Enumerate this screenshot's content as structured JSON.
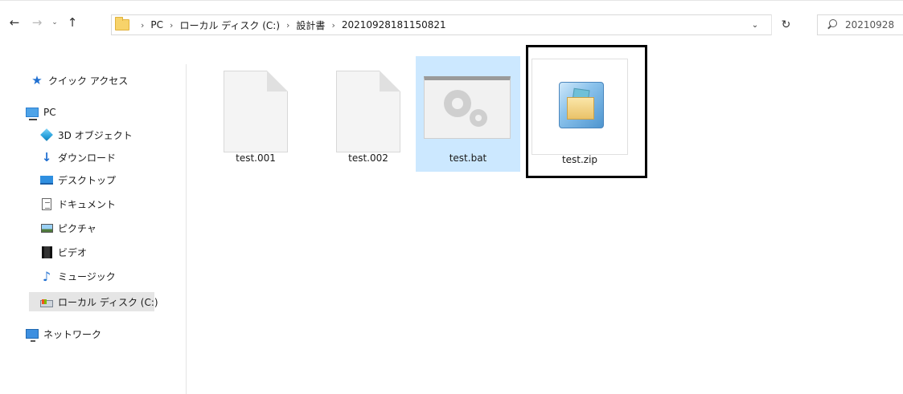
{
  "address": {
    "crumbs": [
      "PC",
      "ローカル ディスク (C:)",
      "設計書",
      "20210928181150821"
    ]
  },
  "search": {
    "value": "20210928"
  },
  "sidebar": {
    "quick_access": "クイック アクセス",
    "pc": "PC",
    "objects3d": "3D オブジェクト",
    "downloads": "ダウンロード",
    "desktop": "デスクトップ",
    "documents": "ドキュメント",
    "pictures": "ピクチャ",
    "videos": "ビデオ",
    "music": "ミュージック",
    "local_disk": "ローカル ディスク (C:)",
    "network": "ネットワーク"
  },
  "files": [
    {
      "name": "test.001"
    },
    {
      "name": "test.002"
    },
    {
      "name": "test.bat"
    },
    {
      "name": "test.zip"
    }
  ],
  "icons": {
    "back": "back-arrow-icon",
    "forward": "forward-arrow-icon",
    "recent": "chevron-down-icon",
    "up": "up-arrow-icon",
    "refresh": "refresh-icon",
    "search": "search-icon"
  },
  "colors": {
    "selected_item_bg": "#cce8ff",
    "sidebar_selected_bg": "#e5e5e5",
    "accent_blue": "#1f6fd1"
  }
}
